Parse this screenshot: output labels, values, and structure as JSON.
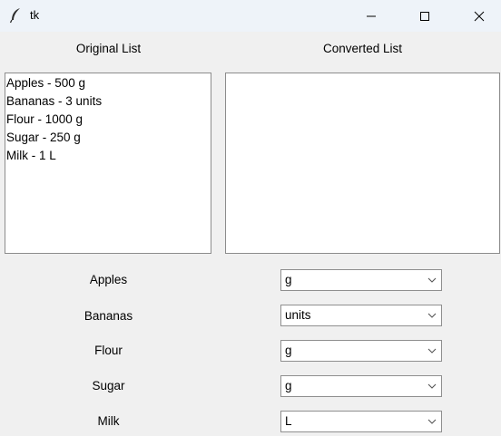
{
  "window": {
    "title": "tk"
  },
  "headings": {
    "original": "Original List",
    "converted": "Converted List"
  },
  "original_list": [
    "Apples - 500 g",
    "Bananas - 3 units",
    "Flour - 1000 g",
    "Sugar - 250 g",
    "Milk - 1 L"
  ],
  "converted_list": [],
  "rows": [
    {
      "label": "Apples",
      "unit": "g"
    },
    {
      "label": "Bananas",
      "unit": "units"
    },
    {
      "label": "Flour",
      "unit": "g"
    },
    {
      "label": "Sugar",
      "unit": "g"
    },
    {
      "label": "Milk",
      "unit": "L"
    }
  ],
  "icons": {
    "app": "feather-icon",
    "minimize": "minimize-icon",
    "maximize": "maximize-icon",
    "close": "close-icon",
    "dropdown": "chevron-down-icon"
  }
}
